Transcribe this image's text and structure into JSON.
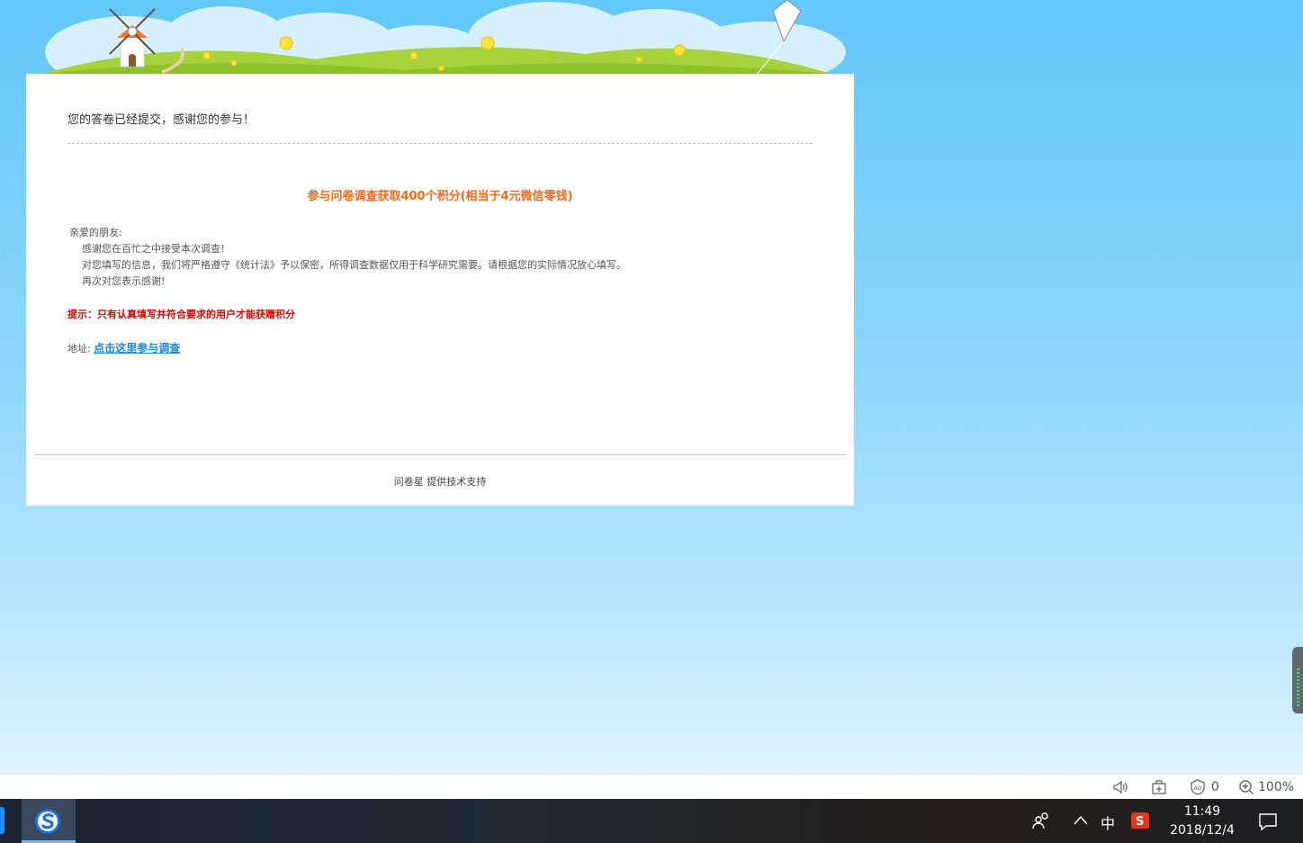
{
  "card": {
    "thanks": "您的答卷已经提交，感谢您的参与！",
    "headline": "参与问卷调查获取400个积分(相当于4元微信零钱)",
    "letter": {
      "greeting": "亲爱的朋友:",
      "line1": "感谢您在百忙之中接受本次调查！",
      "line2": "对您填写的信息，我们将严格遵守《统计法》予以保密，所得调查数据仅用于科学研究需要。请根据您的实际情况放心填写。",
      "line3": "再次对您表示感谢!"
    },
    "tip": "提示：只有认真填写并符合要求的用户才能获赠积分",
    "address_label": "地址:",
    "address_link": "点击这里参与调查",
    "footer": "问卷星 提供技术支持"
  },
  "statusbar": {
    "adblock_count": "0",
    "zoom": "100%"
  },
  "taskbar": {
    "ime_label": "中",
    "time": "11:49",
    "date": "2018/12/4"
  },
  "colors": {
    "headline": "#f26a1b",
    "tip": "#e00000",
    "link": "#1e88d6",
    "sky": "#62c7f9"
  }
}
